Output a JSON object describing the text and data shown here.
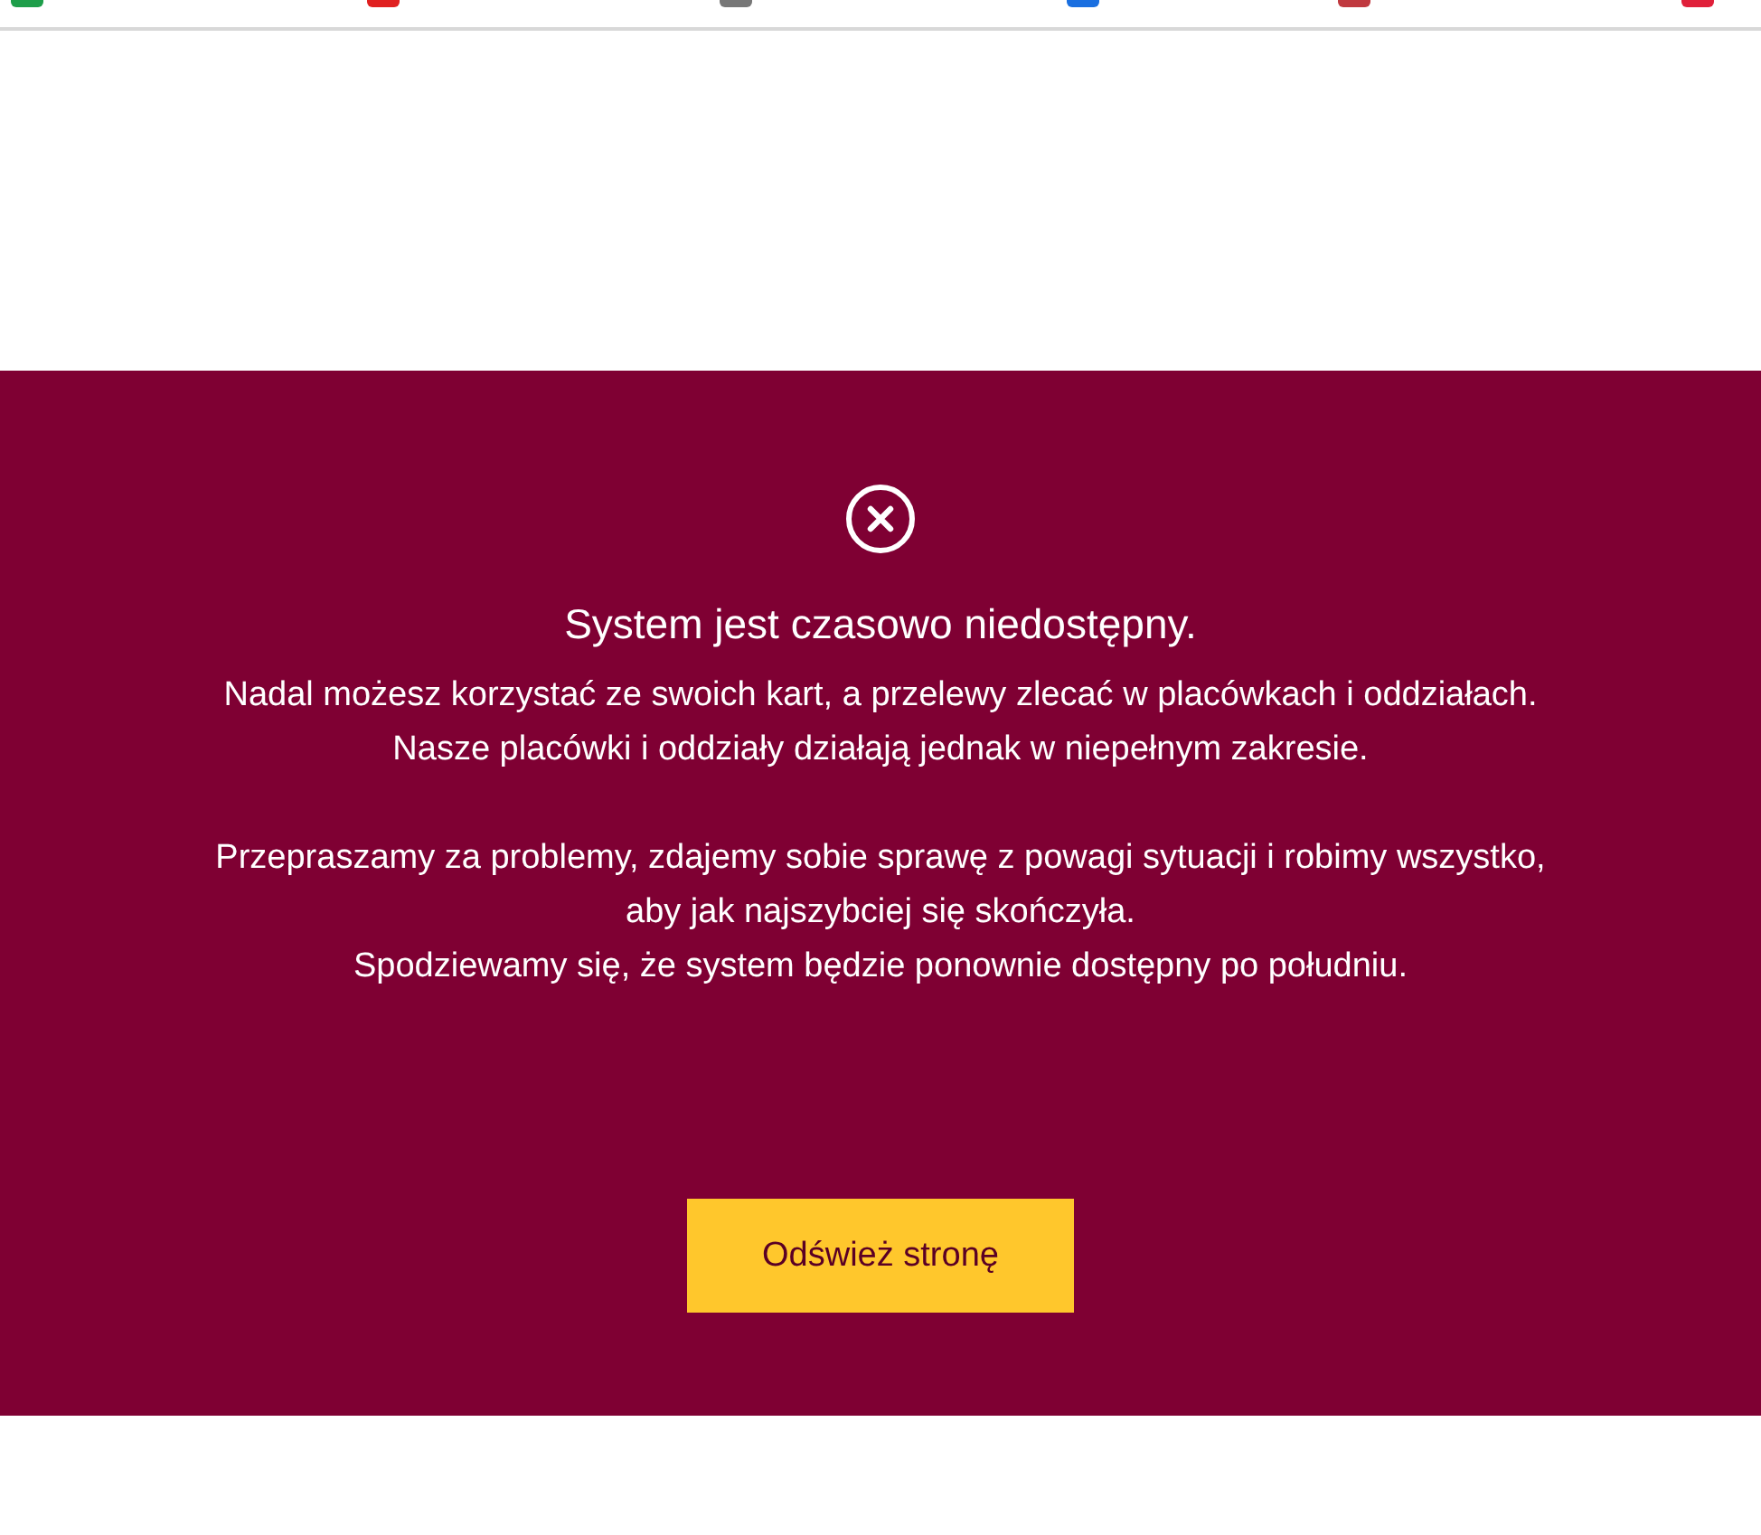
{
  "bookmarks_bar": {
    "icons": [
      {
        "color": "#1e9e4a"
      },
      {
        "color": "#e02020"
      },
      {
        "color": "#777777"
      },
      {
        "color": "#1a6fe0"
      },
      {
        "color": "#c0393f"
      },
      {
        "color": "#e0203a"
      }
    ]
  },
  "notice": {
    "title": "System jest czasowo niedostępny.",
    "paragraphs": [
      [
        "Nadal możesz korzystać ze swoich kart, a przelewy zlecać w placówkach i oddziałach.",
        "Nasze placówki i oddziały działają jednak w niepełnym zakresie."
      ],
      [
        "Przepraszamy za problemy, zdajemy sobie sprawę z powagi sytuacji i robimy wszystko,",
        "aby jak najszybciej się skończyła.",
        "Spodziewamy się, że system będzie ponownie dostępny po południu."
      ]
    ],
    "button": "Odśwież stronę"
  }
}
